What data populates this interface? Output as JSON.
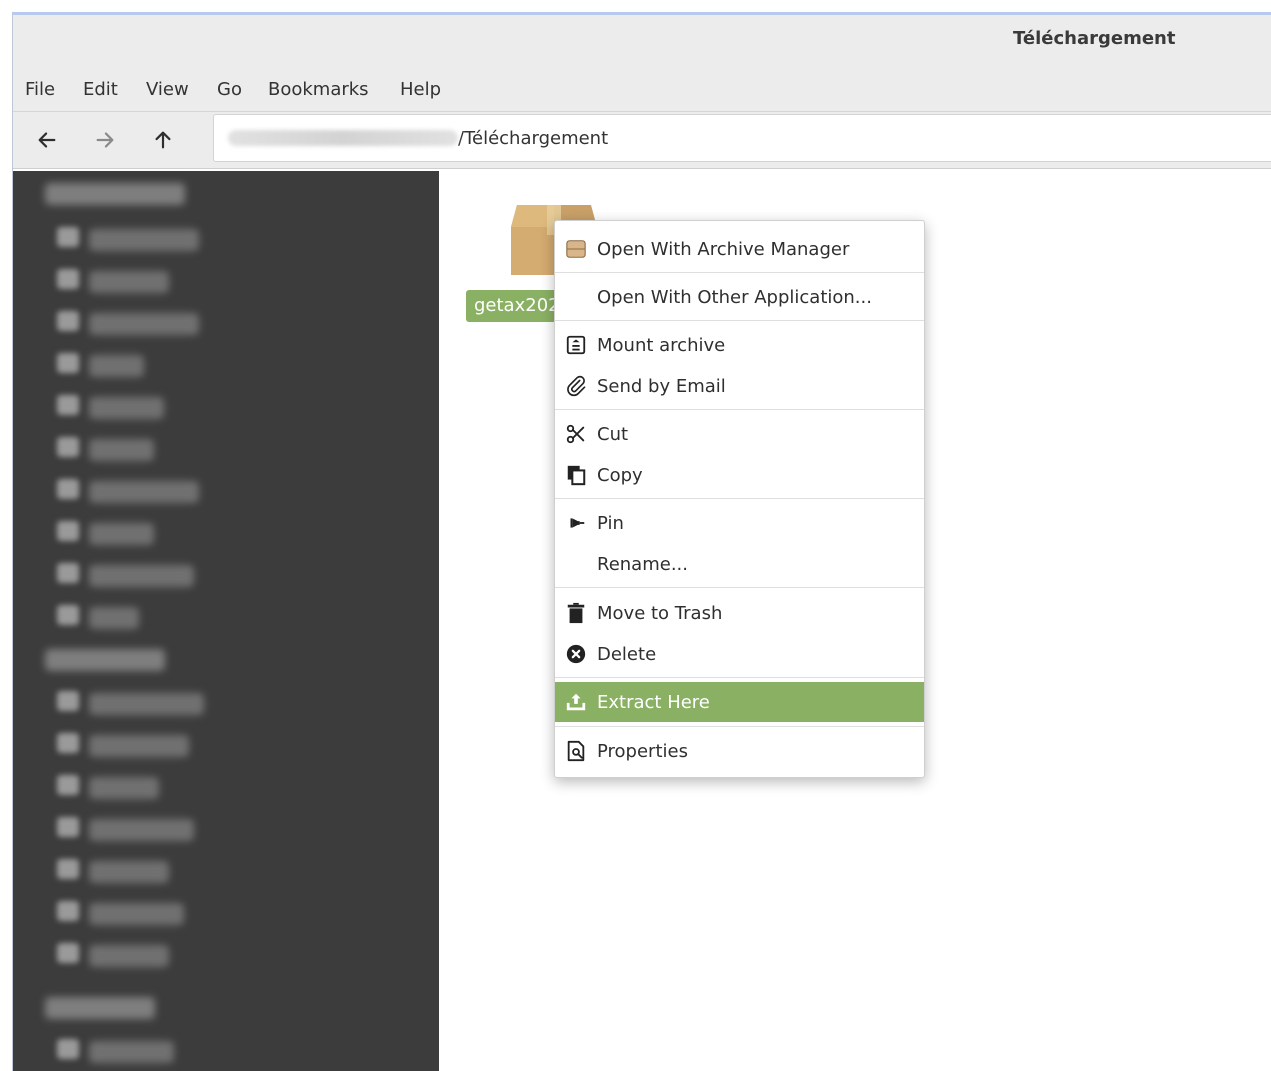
{
  "window": {
    "title": "Téléchargement"
  },
  "menubar": {
    "items": [
      "File",
      "Edit",
      "View",
      "Go",
      "Bookmarks",
      "Help"
    ]
  },
  "toolbar": {
    "location_suffix": "/Téléchargement"
  },
  "content": {
    "file_name": "getax202"
  },
  "context_menu": {
    "items": [
      {
        "label": "Open With Archive Manager",
        "icon": "archive-manager-icon"
      },
      {
        "label": "Open With Other Application...",
        "icon": ""
      },
      {
        "label": "Mount archive",
        "icon": "mount-icon"
      },
      {
        "label": "Send by Email",
        "icon": "paperclip-icon"
      },
      {
        "label": "Cut",
        "icon": "scissors-icon"
      },
      {
        "label": "Copy",
        "icon": "copy-icon"
      },
      {
        "label": "Pin",
        "icon": "pin-icon"
      },
      {
        "label": "Rename...",
        "icon": ""
      },
      {
        "label": "Move to Trash",
        "icon": "trash-icon"
      },
      {
        "label": "Delete",
        "icon": "delete-icon"
      },
      {
        "label": "Extract Here",
        "icon": "extract-icon"
      },
      {
        "label": "Properties",
        "icon": "properties-icon"
      }
    ],
    "highlighted_item": "Extract Here"
  },
  "colors": {
    "accent": "#8ab163",
    "sidebar_bg": "#3c3c3c",
    "chrome_bg": "#ececec"
  }
}
